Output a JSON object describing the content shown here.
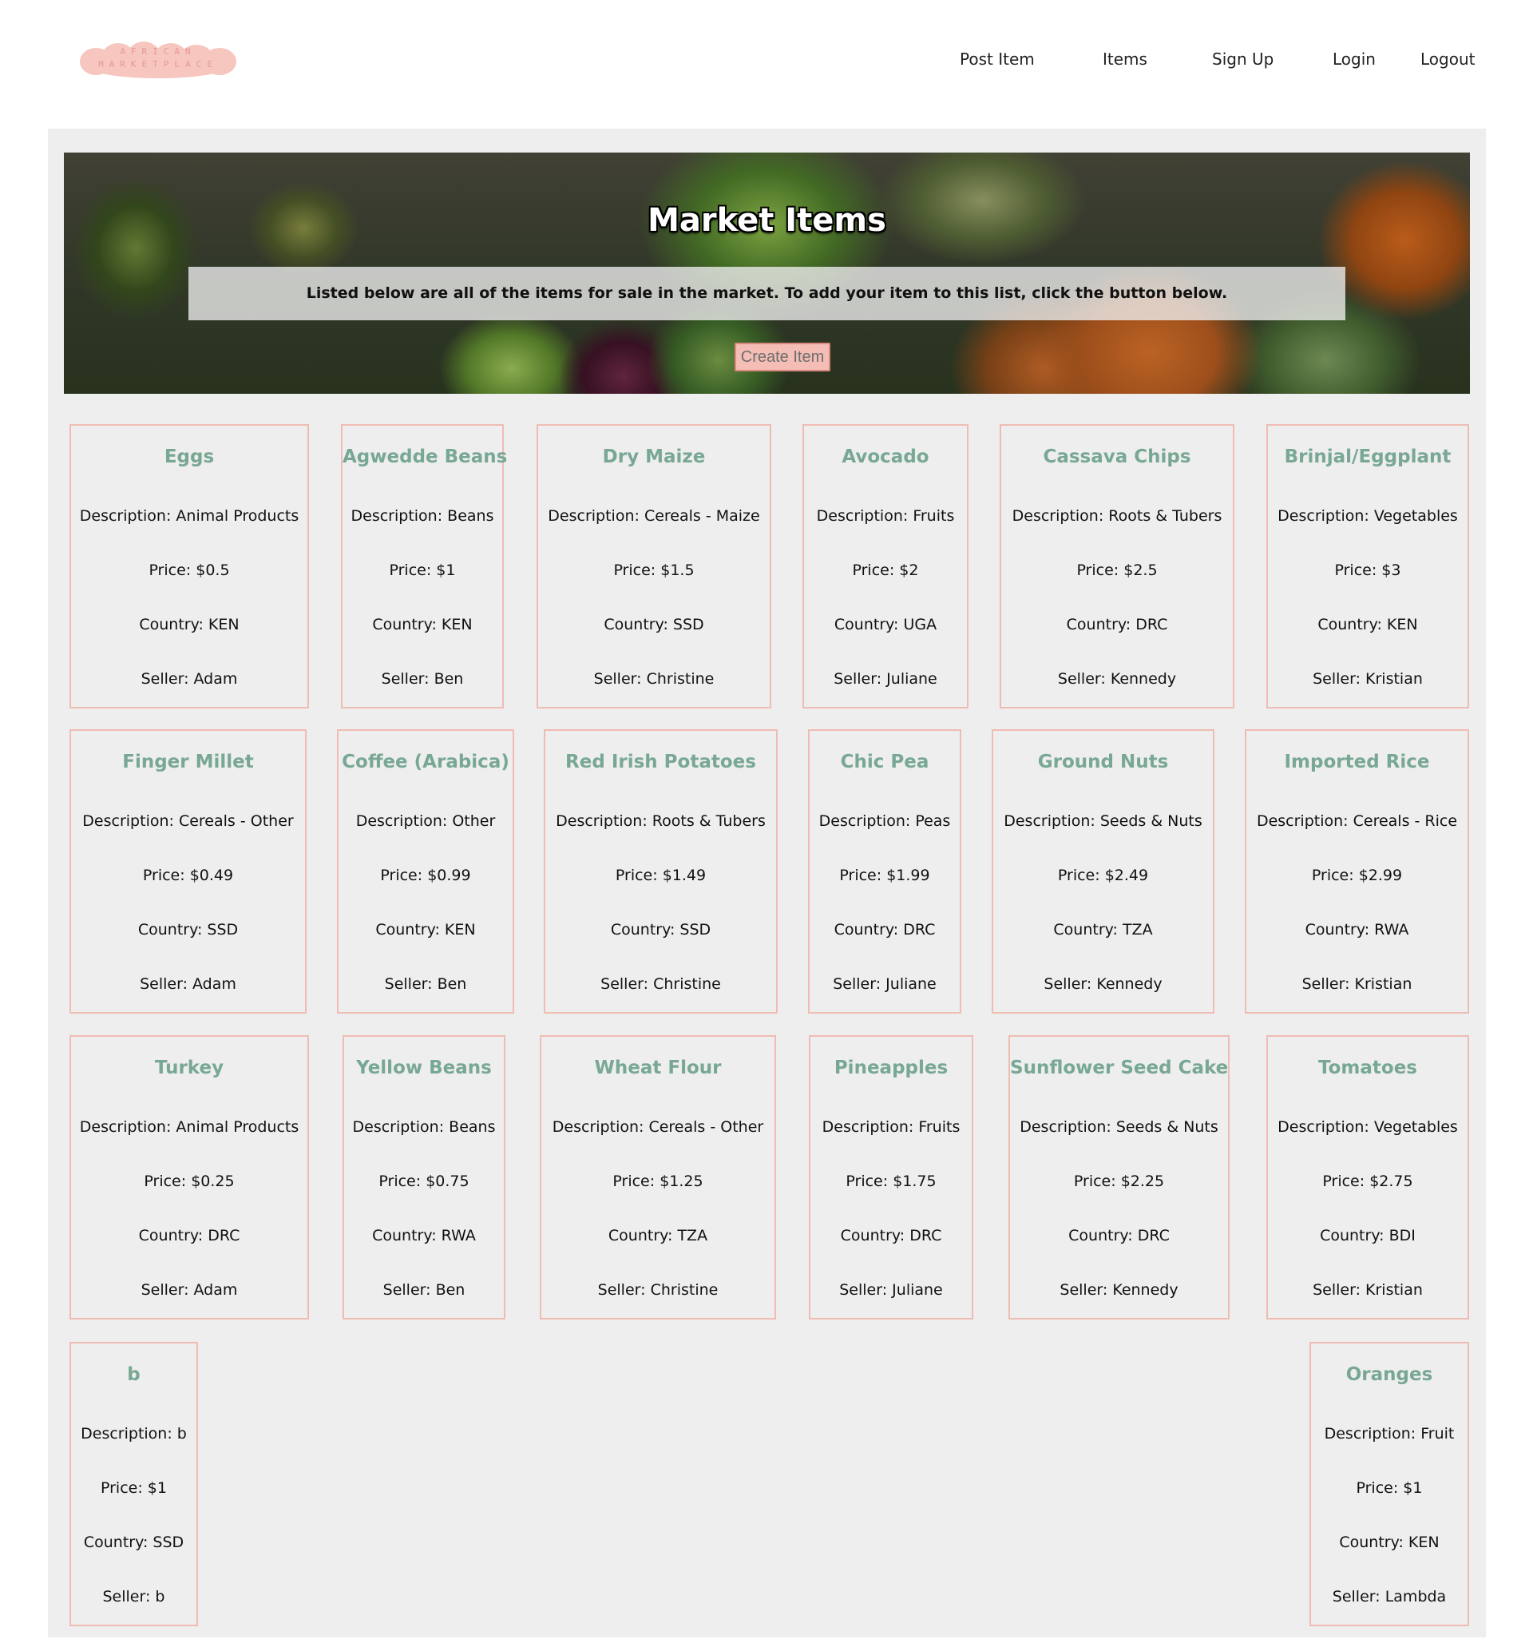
{
  "header": {
    "logo_text_top": "AFRICAN",
    "logo_text_bottom": "MARKETPLACE",
    "nav": [
      "Post Item",
      "Items",
      "Sign Up",
      "Login",
      "Logout"
    ]
  },
  "hero": {
    "title": "Market Items",
    "description": "Listed below are all of the items for sale in the market. To add your item to this list, click the button below.",
    "button_label": "Create Item"
  },
  "labels": {
    "description": "Description: ",
    "price": "Price: ",
    "country": "Country: ",
    "seller": "Seller: "
  },
  "items": [
    {
      "name": "Eggs",
      "description": "Animal Products",
      "price": "$0.5",
      "country": "KEN",
      "seller": "Adam"
    },
    {
      "name": "Agwedde Beans",
      "description": "Beans",
      "price": "$1",
      "country": "KEN",
      "seller": "Ben"
    },
    {
      "name": "Dry Maize",
      "description": "Cereals - Maize",
      "price": "$1.5",
      "country": "SSD",
      "seller": "Christine"
    },
    {
      "name": "Avocado",
      "description": "Fruits",
      "price": "$2",
      "country": "UGA",
      "seller": "Juliane"
    },
    {
      "name": "Cassava Chips",
      "description": "Roots & Tubers",
      "price": "$2.5",
      "country": "DRC",
      "seller": "Kennedy"
    },
    {
      "name": "Brinjal/Eggplant",
      "description": "Vegetables",
      "price": "$3",
      "country": "KEN",
      "seller": "Kristian"
    },
    {
      "name": "Finger Millet",
      "description": "Cereals - Other",
      "price": "$0.49",
      "country": "SSD",
      "seller": "Adam"
    },
    {
      "name": "Coffee (Arabica)",
      "description": "Other",
      "price": "$0.99",
      "country": "KEN",
      "seller": "Ben"
    },
    {
      "name": "Red Irish Potatoes",
      "description": "Roots & Tubers",
      "price": "$1.49",
      "country": "SSD",
      "seller": "Christine"
    },
    {
      "name": "Chic Pea",
      "description": "Peas",
      "price": "$1.99",
      "country": "DRC",
      "seller": "Juliane"
    },
    {
      "name": "Ground Nuts",
      "description": "Seeds & Nuts",
      "price": "$2.49",
      "country": "TZA",
      "seller": "Kennedy"
    },
    {
      "name": "Imported Rice",
      "description": "Cereals - Rice",
      "price": "$2.99",
      "country": "RWA",
      "seller": "Kristian"
    },
    {
      "name": "Turkey",
      "description": "Animal Products",
      "price": "$0.25",
      "country": "DRC",
      "seller": "Adam"
    },
    {
      "name": "Yellow Beans",
      "description": "Beans",
      "price": "$0.75",
      "country": "RWA",
      "seller": "Ben"
    },
    {
      "name": "Wheat Flour",
      "description": "Cereals - Other",
      "price": "$1.25",
      "country": "TZA",
      "seller": "Christine"
    },
    {
      "name": "Pineapples",
      "description": "Fruits",
      "price": "$1.75",
      "country": "DRC",
      "seller": "Juliane"
    },
    {
      "name": "Sunflower Seed Cake",
      "description": "Seeds & Nuts",
      "price": "$2.25",
      "country": "DRC",
      "seller": "Kennedy"
    },
    {
      "name": "Tomatoes",
      "description": "Vegetables",
      "price": "$2.75",
      "country": "BDI",
      "seller": "Kristian"
    },
    {
      "name": "b",
      "description": "b",
      "price": "$1",
      "country": "SSD",
      "seller": "b"
    },
    {
      "name": "Oranges",
      "description": "Fruit",
      "price": "$1",
      "country": "KEN",
      "seller": "Lambda"
    }
  ]
}
